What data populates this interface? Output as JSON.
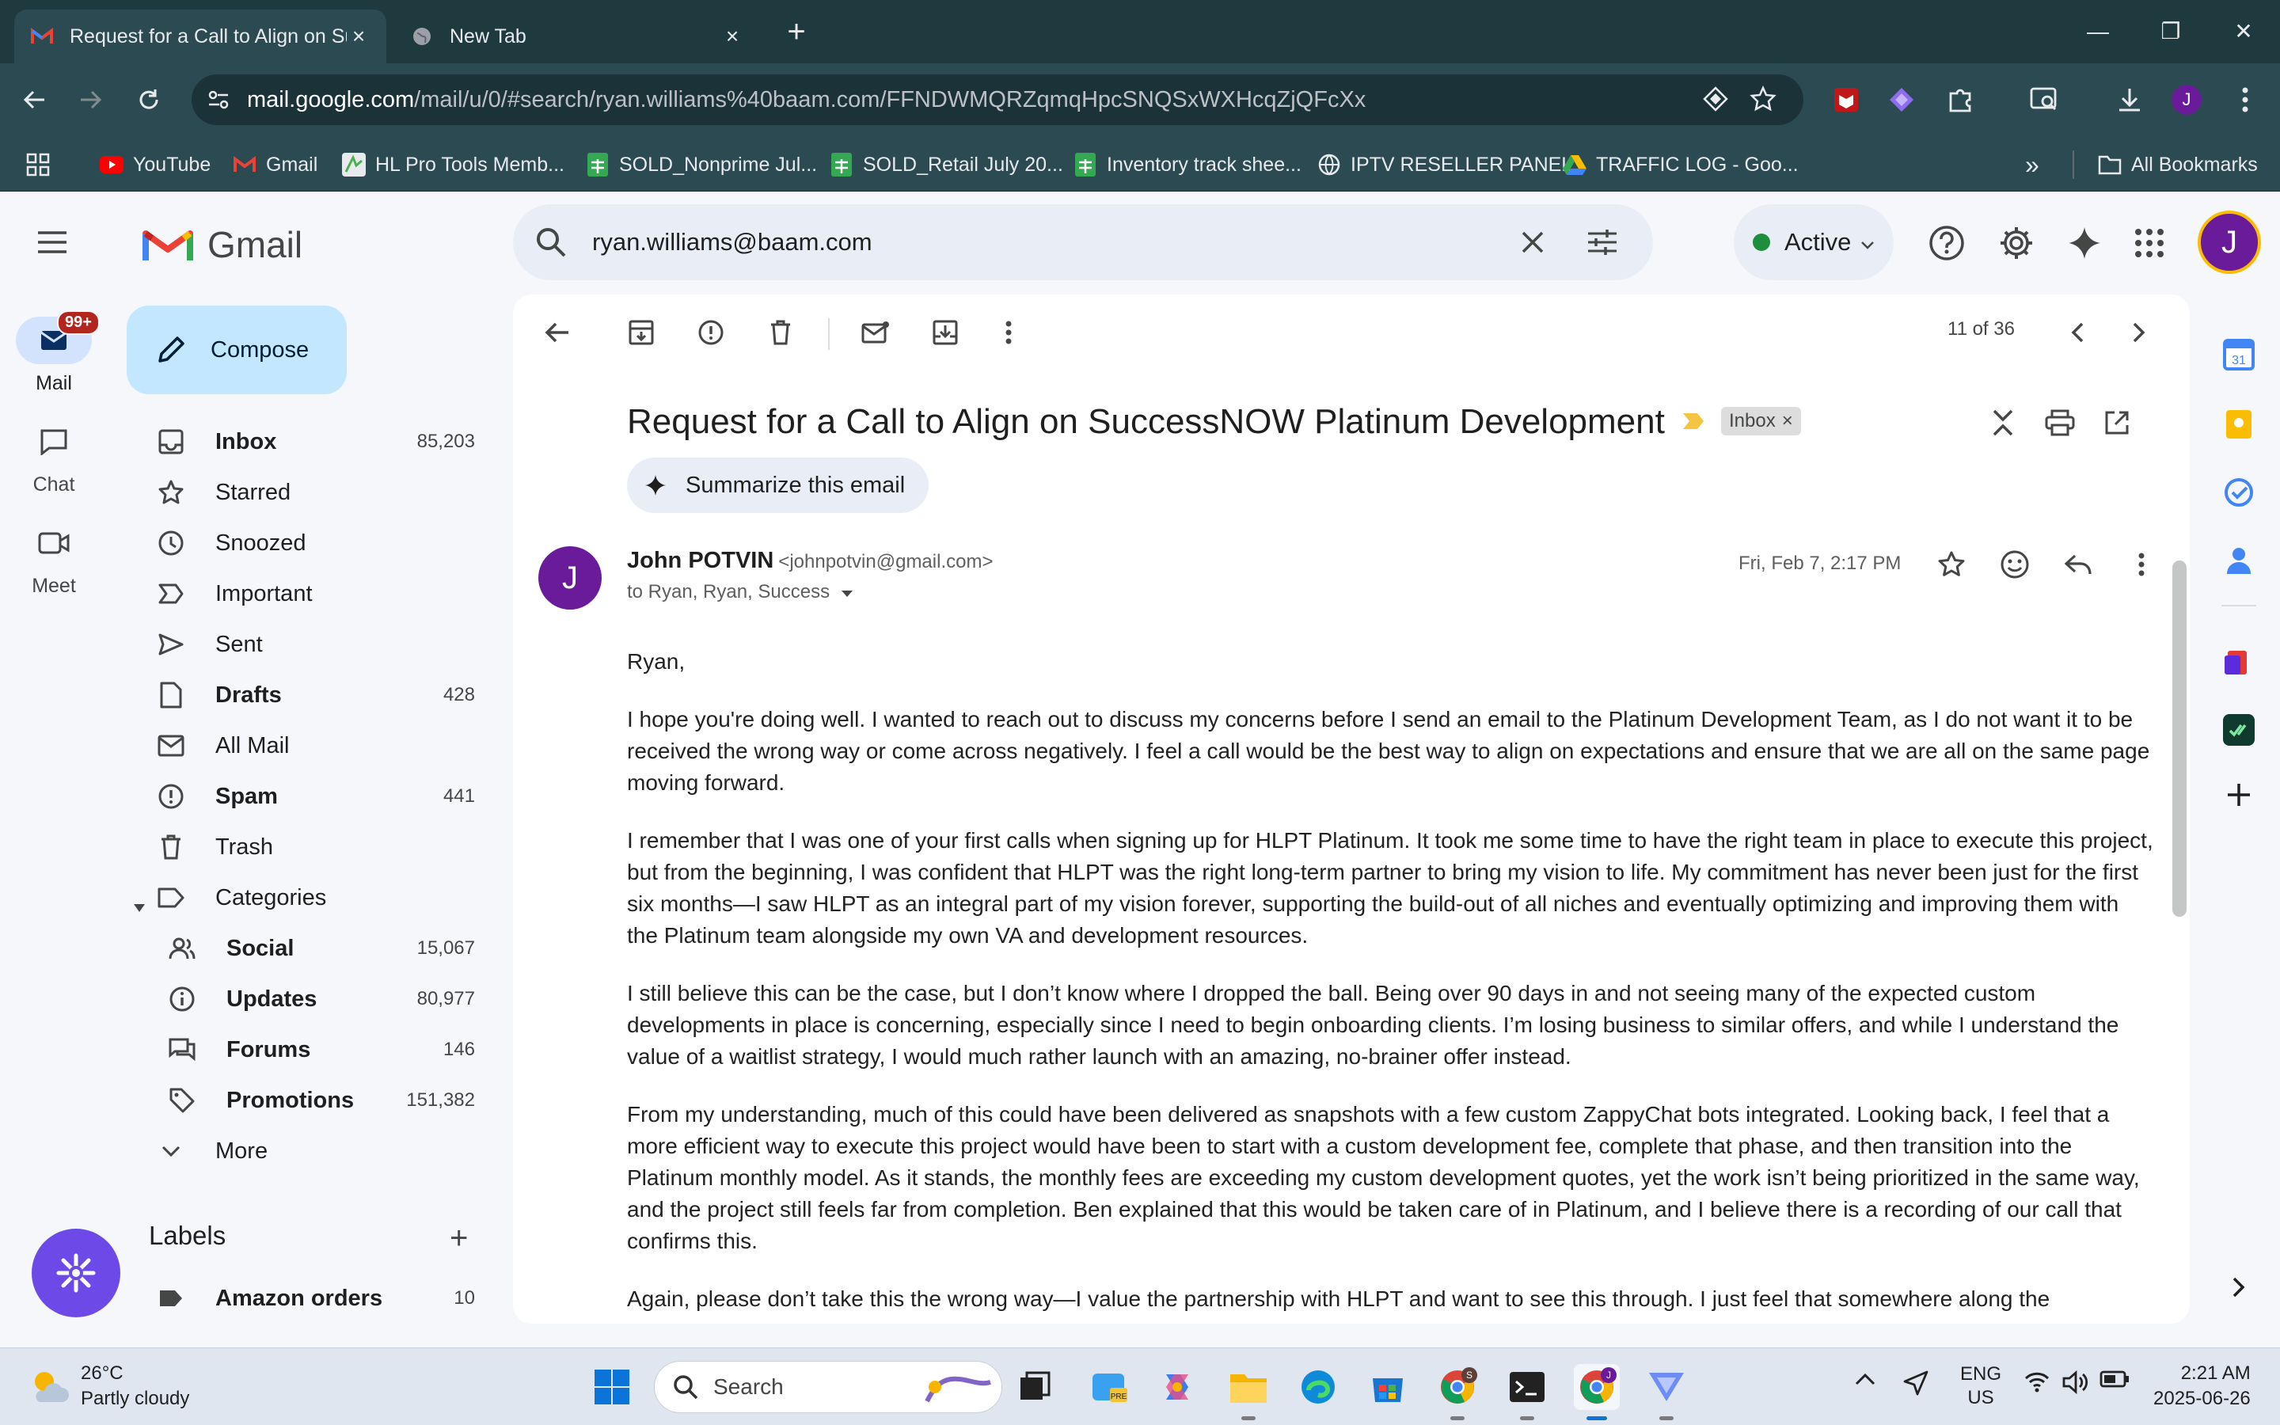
{
  "browser": {
    "tabs": [
      {
        "title": "Request for a Call to Align on Su",
        "active": true
      },
      {
        "title": "New Tab",
        "active": false
      }
    ],
    "url_host": "mail.google.com",
    "url_path": "/mail/u/0/#search/ryan.williams%40baam.com/FFNDWMQRZqmqHpcSNQSxWXHcqZjQFcXx",
    "profile_initial": "J",
    "bookmarks": [
      {
        "label": "YouTube",
        "icon": "youtube-icon"
      },
      {
        "label": "Gmail",
        "icon": "gmail-icon"
      },
      {
        "label": "HL Pro Tools Memb...",
        "icon": "hl-icon"
      },
      {
        "label": "SOLD_Nonprime Jul...",
        "icon": "sheets-icon"
      },
      {
        "label": "SOLD_Retail July 20...",
        "icon": "sheets-icon"
      },
      {
        "label": "Inventory track shee...",
        "icon": "sheets-icon"
      },
      {
        "label": "IPTV RESELLER PANEL",
        "icon": "globe-icon"
      },
      {
        "label": "TRAFFIC LOG - Goo...",
        "icon": "drive-icon"
      }
    ],
    "all_bookmarks": "All Bookmarks",
    "more_bookmarks": "»"
  },
  "gmail": {
    "brand": "Gmail",
    "rail": [
      {
        "label": "Mail",
        "badge": "99+"
      },
      {
        "label": "Chat"
      },
      {
        "label": "Meet"
      }
    ],
    "compose_label": "Compose",
    "nav": [
      {
        "label": "Inbox",
        "count": "85,203",
        "bold": true,
        "icon": "inbox-icon"
      },
      {
        "label": "Starred",
        "count": "",
        "bold": false,
        "icon": "star-icon"
      },
      {
        "label": "Snoozed",
        "count": "",
        "bold": false,
        "icon": "clock-icon"
      },
      {
        "label": "Important",
        "count": "",
        "bold": false,
        "icon": "important-icon"
      },
      {
        "label": "Sent",
        "count": "",
        "bold": false,
        "icon": "send-icon"
      },
      {
        "label": "Drafts",
        "count": "428",
        "bold": true,
        "icon": "draft-icon"
      },
      {
        "label": "All Mail",
        "count": "",
        "bold": false,
        "icon": "all-mail-icon"
      },
      {
        "label": "Spam",
        "count": "441",
        "bold": true,
        "icon": "spam-icon"
      },
      {
        "label": "Trash",
        "count": "",
        "bold": false,
        "icon": "trash-icon"
      },
      {
        "label": "Categories",
        "count": "",
        "bold": false,
        "icon": "label-icon"
      }
    ],
    "categories": [
      {
        "label": "Social",
        "count": "15,067",
        "icon": "social-icon"
      },
      {
        "label": "Updates",
        "count": "80,977",
        "icon": "info-icon"
      },
      {
        "label": "Forums",
        "count": "146",
        "icon": "forum-icon"
      },
      {
        "label": "Promotions",
        "count": "151,382",
        "icon": "tag-icon"
      }
    ],
    "more_label": "More",
    "labels_heading": "Labels",
    "labels": [
      {
        "label": "Amazon orders",
        "count": "10"
      }
    ],
    "search_value": "ryan.williams@baam.com",
    "status_label": "Active",
    "pager": "11 of 36",
    "subject": "Request for a Call to Align on SuccessNOW Platinum Development",
    "chip_label": "Inbox",
    "summarize_label": "Summarize this email",
    "sender_initial": "J",
    "sender_name": "John POTVIN",
    "sender_email": "<johnpotvin@gmail.com>",
    "recipients": "to Ryan, Ryan, Success",
    "date": "Fri, Feb 7, 2:17 PM",
    "body": [
      "Ryan,",
      "I hope you're doing well. I wanted to reach out to discuss my concerns before I send an email to the Platinum Development Team, as I do not want it to be received the wrong way or come across negatively. I feel a call would be the best way to align on expectations and ensure that we are all on the same page moving forward.",
      "I remember that I was one of your first calls when signing up for HLPT Platinum. It took me some time to have the right team in place to execute this project, but from the beginning, I was confident that HLPT was the right long-term partner to bring my vision to life. My commitment has never been just for the first six months—I saw HLPT as an integral part of my vision forever, supporting the build-out of all niches and eventually optimizing and improving them with the Platinum team alongside my own VA and development resources.",
      "I still believe this can be the case, but I don’t know where I dropped the ball. Being over 90 days in and not seeing many of the expected custom developments in place is concerning, especially since I need to begin onboarding clients. I’m losing business to similar offers, and while I understand the value of a waitlist strategy, I would much rather launch with an amazing, no-brainer offer instead.",
      "From my understanding, much of this could have been delivered as snapshots with a few custom ZappyChat bots integrated. Looking back, I feel that a more efficient way to execute this project would have been to start with a custom development fee, complete that phase, and then transition into the Platinum monthly model. As it stands, the monthly fees are exceeding my custom development quotes, yet the work isn’t being prioritized in the same way, and the project still feels far from completion. Ben explained that this would be taken care of in Platinum, and I believe there is a recording of our call that confirms this.",
      "Again, please don’t take this the wrong way—I value the partnership with HLPT and want to see this through. I just feel that somewhere along the"
    ]
  },
  "taskbar": {
    "temperature": "26°C",
    "weather": "Partly cloudy",
    "search_label": "Search",
    "lang_top": "ENG",
    "lang_bottom": "US",
    "time": "2:21 AM",
    "date": "2025-06-26"
  },
  "colors": {
    "chrome_dark": "#1f3a3f",
    "chrome": "#2c4a52",
    "compose": "#c2e7ff",
    "avatar": "#6a1b9a",
    "active_dot": "#1e8e3e"
  }
}
